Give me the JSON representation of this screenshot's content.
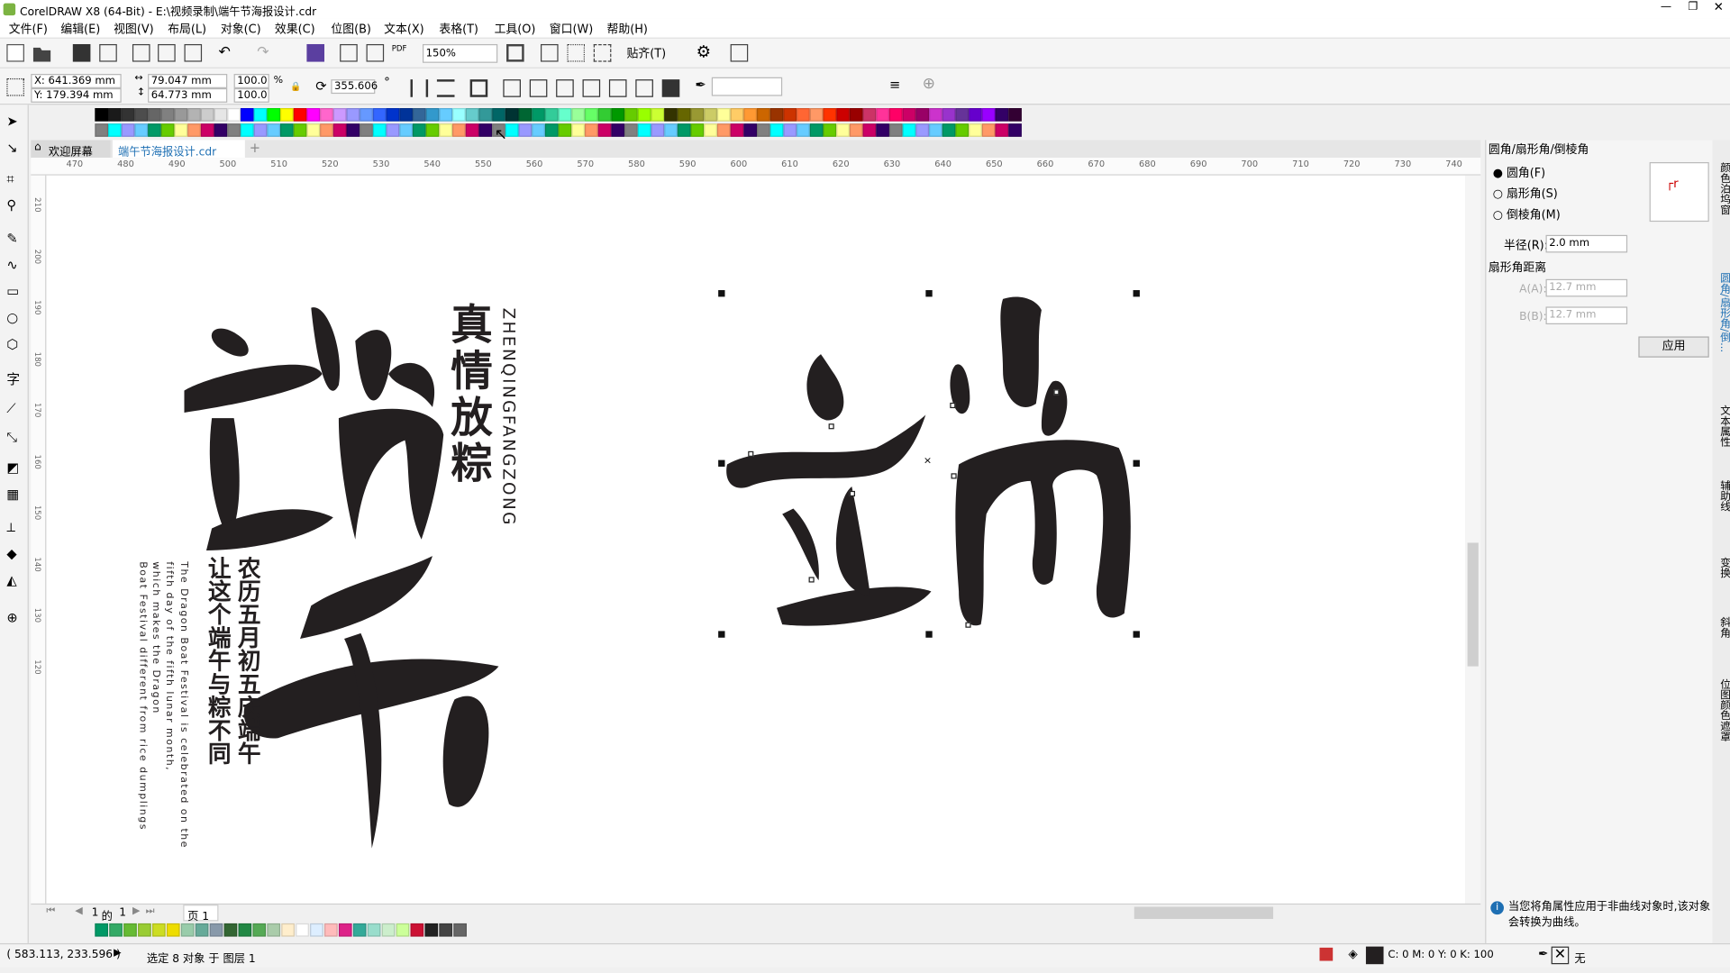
{
  "app": {
    "title": "CorelDRAW X8 (64-Bit) - E:\\视频录制\\端午节海报设计.cdr"
  },
  "menu": [
    "文件(F)",
    "编辑(E)",
    "视图(V)",
    "布局(L)",
    "对象(C)",
    "效果(C)",
    "位图(B)",
    "文本(X)",
    "表格(T)",
    "工具(O)",
    "窗口(W)",
    "帮助(H)"
  ],
  "toolbar": {
    "zoom": "150%",
    "snap": "贴齐(T)"
  },
  "props": {
    "x": "X: 641.369 mm",
    "y": "Y: 179.394 mm",
    "w": "79.047 mm",
    "h": "64.773 mm",
    "sx": "100.0",
    "sy": "100.0",
    "pct": "%",
    "angle": "355.606",
    "deg": "°"
  },
  "tabs": {
    "welcome": "欢迎屏幕",
    "doc": "端午节海报设计.cdr"
  },
  "ruler": {
    "h": [
      "470",
      "480",
      "490",
      "500",
      "510",
      "520",
      "530",
      "540",
      "550",
      "560",
      "570",
      "580",
      "590",
      "600",
      "610",
      "620",
      "630",
      "640",
      "650",
      "660",
      "670",
      "680",
      "690",
      "700",
      "710",
      "720",
      "730",
      "740"
    ],
    "v": [
      "210",
      "200",
      "190",
      "180",
      "170",
      "160",
      "150",
      "140",
      "130",
      "120"
    ]
  },
  "poster": {
    "big1": "端",
    "big2": "午",
    "v1": "真情放粽",
    "pinyin": "ZHENQINGFANGZONG",
    "col1": "农历五月初五庆端午",
    "col2": "让这个端午与粽不同",
    "en1": "The Dragon Boat Festival is celebrated on the",
    "en2": "fifth day of the fifth lunar month,",
    "en3": "which makes the Dragon",
    "en4": "Boat Festival different from rice dumplings",
    "sel": "端"
  },
  "pagenav": {
    "current": "1",
    "of": "的",
    "total": "1",
    "page": "页 1"
  },
  "docker": {
    "title": "圆角/扇形角/倒棱角",
    "opt1": "圆角(F)",
    "opt2": "扇形角(S)",
    "opt3": "倒棱角(M)",
    "radius_label": "半径(R):",
    "radius": "2.0 mm",
    "dist_label": "扇形角距离",
    "a_label": "A(A):",
    "a": "12.7 mm",
    "b_label": "B(B):",
    "b": "12.7 mm",
    "apply": "应用",
    "info": "当您将角属性应用于非曲线对象时,该对象会转换为曲线。"
  },
  "sidetabs": [
    "颜色泊坞窗",
    "圆角/扇形角/倒...",
    "文本属性",
    "辅助线",
    "变换",
    "斜角",
    "位图颜色遮罩"
  ],
  "status": {
    "coords": "( 583.113, 233.596 )",
    "sel": "选定 8 对象 于 图层 1",
    "fill": "C: 0 M: 0 Y: 0 K: 100",
    "outline": "无"
  },
  "colors": {
    "ink": "#231f20",
    "accent": "#1e6fb3"
  }
}
